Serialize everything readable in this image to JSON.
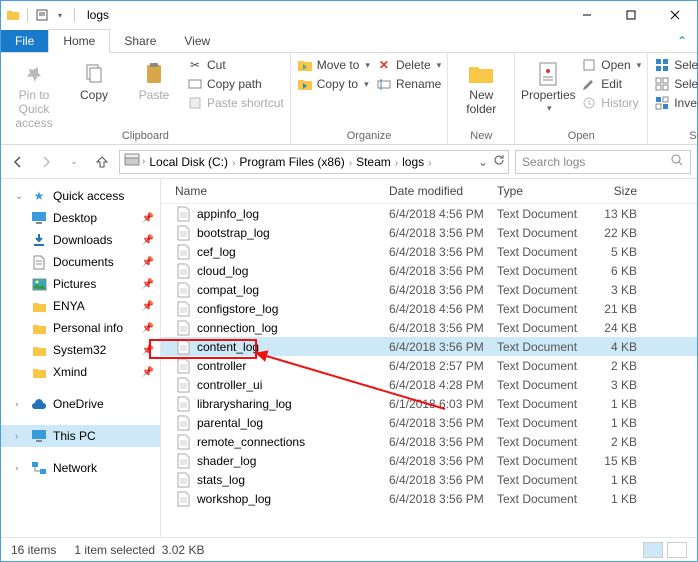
{
  "window": {
    "title": "logs"
  },
  "tabs": {
    "file": "File",
    "home": "Home",
    "share": "Share",
    "view": "View"
  },
  "ribbon": {
    "clipboard": {
      "label": "Clipboard",
      "pin": "Pin to Quick\naccess",
      "copy": "Copy",
      "paste": "Paste",
      "cut": "Cut",
      "copypath": "Copy path",
      "shortcut": "Paste shortcut"
    },
    "organize": {
      "label": "Organize",
      "moveto": "Move to",
      "copyto": "Copy to",
      "delete": "Delete",
      "rename": "Rename"
    },
    "new": {
      "label": "New",
      "newfolder": "New\nfolder"
    },
    "open": {
      "label": "Open",
      "properties": "Properties",
      "open": "Open",
      "edit": "Edit",
      "history": "History"
    },
    "select": {
      "label": "Select",
      "all": "Select all",
      "none": "Select none",
      "invert": "Invert selection"
    }
  },
  "breadcrumbs": [
    "Local Disk (C:)",
    "Program Files (x86)",
    "Steam",
    "logs"
  ],
  "search": {
    "placeholder": "Search logs"
  },
  "sidebar": {
    "quick": "Quick access",
    "pinned": [
      "Desktop",
      "Downloads",
      "Documents",
      "Pictures",
      "ENYA",
      "Personal info",
      "System32",
      "Xmind"
    ],
    "onedrive": "OneDrive",
    "thispc": "This PC",
    "network": "Network"
  },
  "columns": {
    "name": "Name",
    "date": "Date modified",
    "type": "Type",
    "size": "Size"
  },
  "files": [
    {
      "name": "appinfo_log",
      "date": "6/4/2018 4:56 PM",
      "type": "Text Document",
      "size": "13 KB",
      "sel": false
    },
    {
      "name": "bootstrap_log",
      "date": "6/4/2018 3:56 PM",
      "type": "Text Document",
      "size": "22 KB",
      "sel": false
    },
    {
      "name": "cef_log",
      "date": "6/4/2018 3:56 PM",
      "type": "Text Document",
      "size": "5 KB",
      "sel": false
    },
    {
      "name": "cloud_log",
      "date": "6/4/2018 3:56 PM",
      "type": "Text Document",
      "size": "6 KB",
      "sel": false
    },
    {
      "name": "compat_log",
      "date": "6/4/2018 3:56 PM",
      "type": "Text Document",
      "size": "3 KB",
      "sel": false
    },
    {
      "name": "configstore_log",
      "date": "6/4/2018 4:56 PM",
      "type": "Text Document",
      "size": "21 KB",
      "sel": false
    },
    {
      "name": "connection_log",
      "date": "6/4/2018 3:56 PM",
      "type": "Text Document",
      "size": "24 KB",
      "sel": false
    },
    {
      "name": "content_log",
      "date": "6/4/2018 3:56 PM",
      "type": "Text Document",
      "size": "4 KB",
      "sel": true
    },
    {
      "name": "controller",
      "date": "6/4/2018 2:57 PM",
      "type": "Text Document",
      "size": "2 KB",
      "sel": false
    },
    {
      "name": "controller_ui",
      "date": "6/4/2018 4:28 PM",
      "type": "Text Document",
      "size": "3 KB",
      "sel": false
    },
    {
      "name": "librarysharing_log",
      "date": "6/1/2018 6:03 PM",
      "type": "Text Document",
      "size": "1 KB",
      "sel": false
    },
    {
      "name": "parental_log",
      "date": "6/4/2018 3:56 PM",
      "type": "Text Document",
      "size": "1 KB",
      "sel": false
    },
    {
      "name": "remote_connections",
      "date": "6/4/2018 3:56 PM",
      "type": "Text Document",
      "size": "2 KB",
      "sel": false
    },
    {
      "name": "shader_log",
      "date": "6/4/2018 3:56 PM",
      "type": "Text Document",
      "size": "15 KB",
      "sel": false
    },
    {
      "name": "stats_log",
      "date": "6/4/2018 3:56 PM",
      "type": "Text Document",
      "size": "1 KB",
      "sel": false
    },
    {
      "name": "workshop_log",
      "date": "6/4/2018 3:56 PM",
      "type": "Text Document",
      "size": "1 KB",
      "sel": false
    }
  ],
  "status": {
    "count": "16 items",
    "selected": "1 item selected",
    "size": "3.02 KB"
  }
}
